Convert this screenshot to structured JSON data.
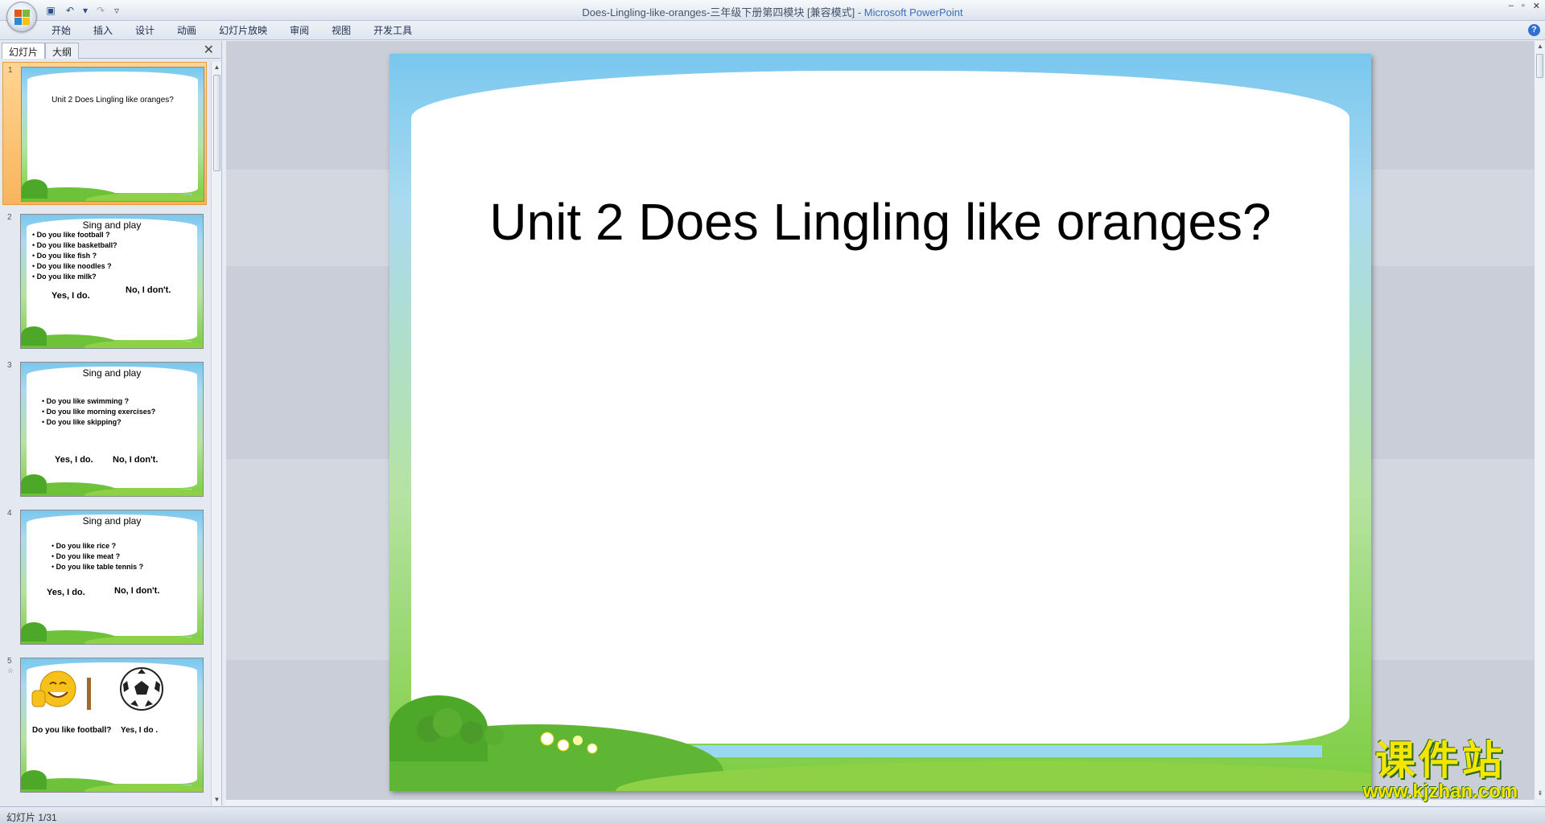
{
  "window": {
    "title_doc": "Does-Lingling-like-oranges-三年级下册第四模块 [兼容模式]",
    "title_sep": " - ",
    "title_app": "Microsoft PowerPoint",
    "controls": [
      "–",
      "▫",
      "✕"
    ]
  },
  "quick_access": [
    {
      "name": "save-icon",
      "glyph": "▣"
    },
    {
      "name": "undo-icon",
      "glyph": "↶"
    },
    {
      "name": "undo-dropdown-icon",
      "glyph": "▾"
    },
    {
      "name": "redo-icon",
      "glyph": "↷"
    },
    {
      "name": "customize-qat-icon",
      "glyph": "▿"
    }
  ],
  "ribbon": {
    "tabs": [
      "开始",
      "插入",
      "设计",
      "动画",
      "幻灯片放映",
      "审阅",
      "视图",
      "开发工具"
    ],
    "help": "?"
  },
  "left_panel": {
    "tabs": [
      "幻灯片",
      "大纲"
    ],
    "close": "✕",
    "slides": [
      {
        "num": "1",
        "title": "Unit 2 Does Lingling like oranges?"
      },
      {
        "num": "2",
        "heading": "Sing and play",
        "items": [
          "Do you like football ?",
          "Do you like basketball?",
          "Do you like fish ?",
          "Do you like noodles ?",
          "Do you like milk?"
        ],
        "yes": "Yes, I do.",
        "no": "No, I don't."
      },
      {
        "num": "3",
        "heading": "Sing and play",
        "items": [
          "Do you like swimming ?",
          "Do you like morning exercises?",
          "Do you like skipping?"
        ],
        "yes": "Yes, I do.",
        "no": "No, I don't."
      },
      {
        "num": "4",
        "heading": "Sing and play",
        "items": [
          "Do you like rice ?",
          "Do you like meat ?",
          "Do you like table tennis ?"
        ],
        "yes": "Yes, I do.",
        "no": "No, I don't."
      },
      {
        "num": "5",
        "star": "☆",
        "question": "Do you  like football?",
        "answer": "Yes, I do ."
      }
    ]
  },
  "slide": {
    "title": "Unit 2 Does Lingling like oranges?"
  },
  "watermark": {
    "cn": "课件站",
    "url": "www.kjzhan.com"
  },
  "status": {
    "slide_counter": "幻灯片 1/31"
  }
}
